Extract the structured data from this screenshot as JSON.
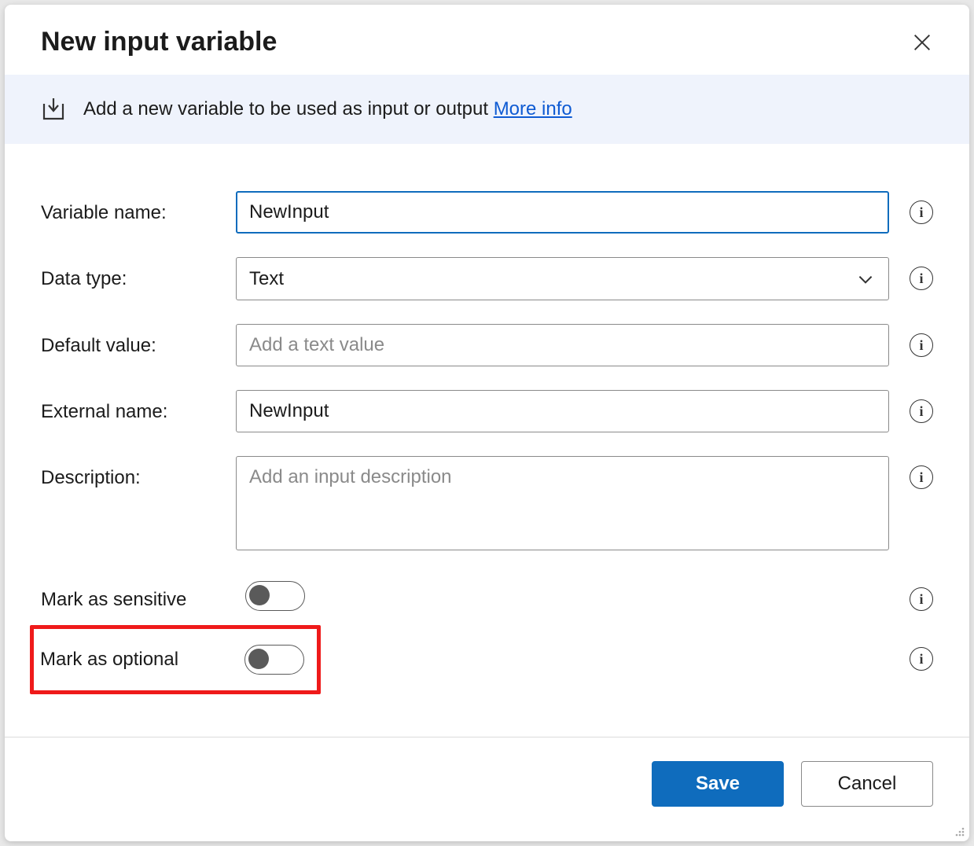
{
  "dialog": {
    "title": "New input variable"
  },
  "infoBar": {
    "text": "Add a new variable to be used as input or output ",
    "linkText": "More info"
  },
  "fields": {
    "variableName": {
      "label": "Variable name:",
      "value": "NewInput"
    },
    "dataType": {
      "label": "Data type:",
      "value": "Text"
    },
    "defaultValue": {
      "label": "Default value:",
      "value": "",
      "placeholder": "Add a text value"
    },
    "externalName": {
      "label": "External name:",
      "value": "NewInput"
    },
    "description": {
      "label": "Description:",
      "value": "",
      "placeholder": "Add an input description"
    },
    "markSensitive": {
      "label": "Mark as sensitive",
      "on": false
    },
    "markOptional": {
      "label": "Mark as optional",
      "on": false
    }
  },
  "footer": {
    "save": "Save",
    "cancel": "Cancel"
  }
}
